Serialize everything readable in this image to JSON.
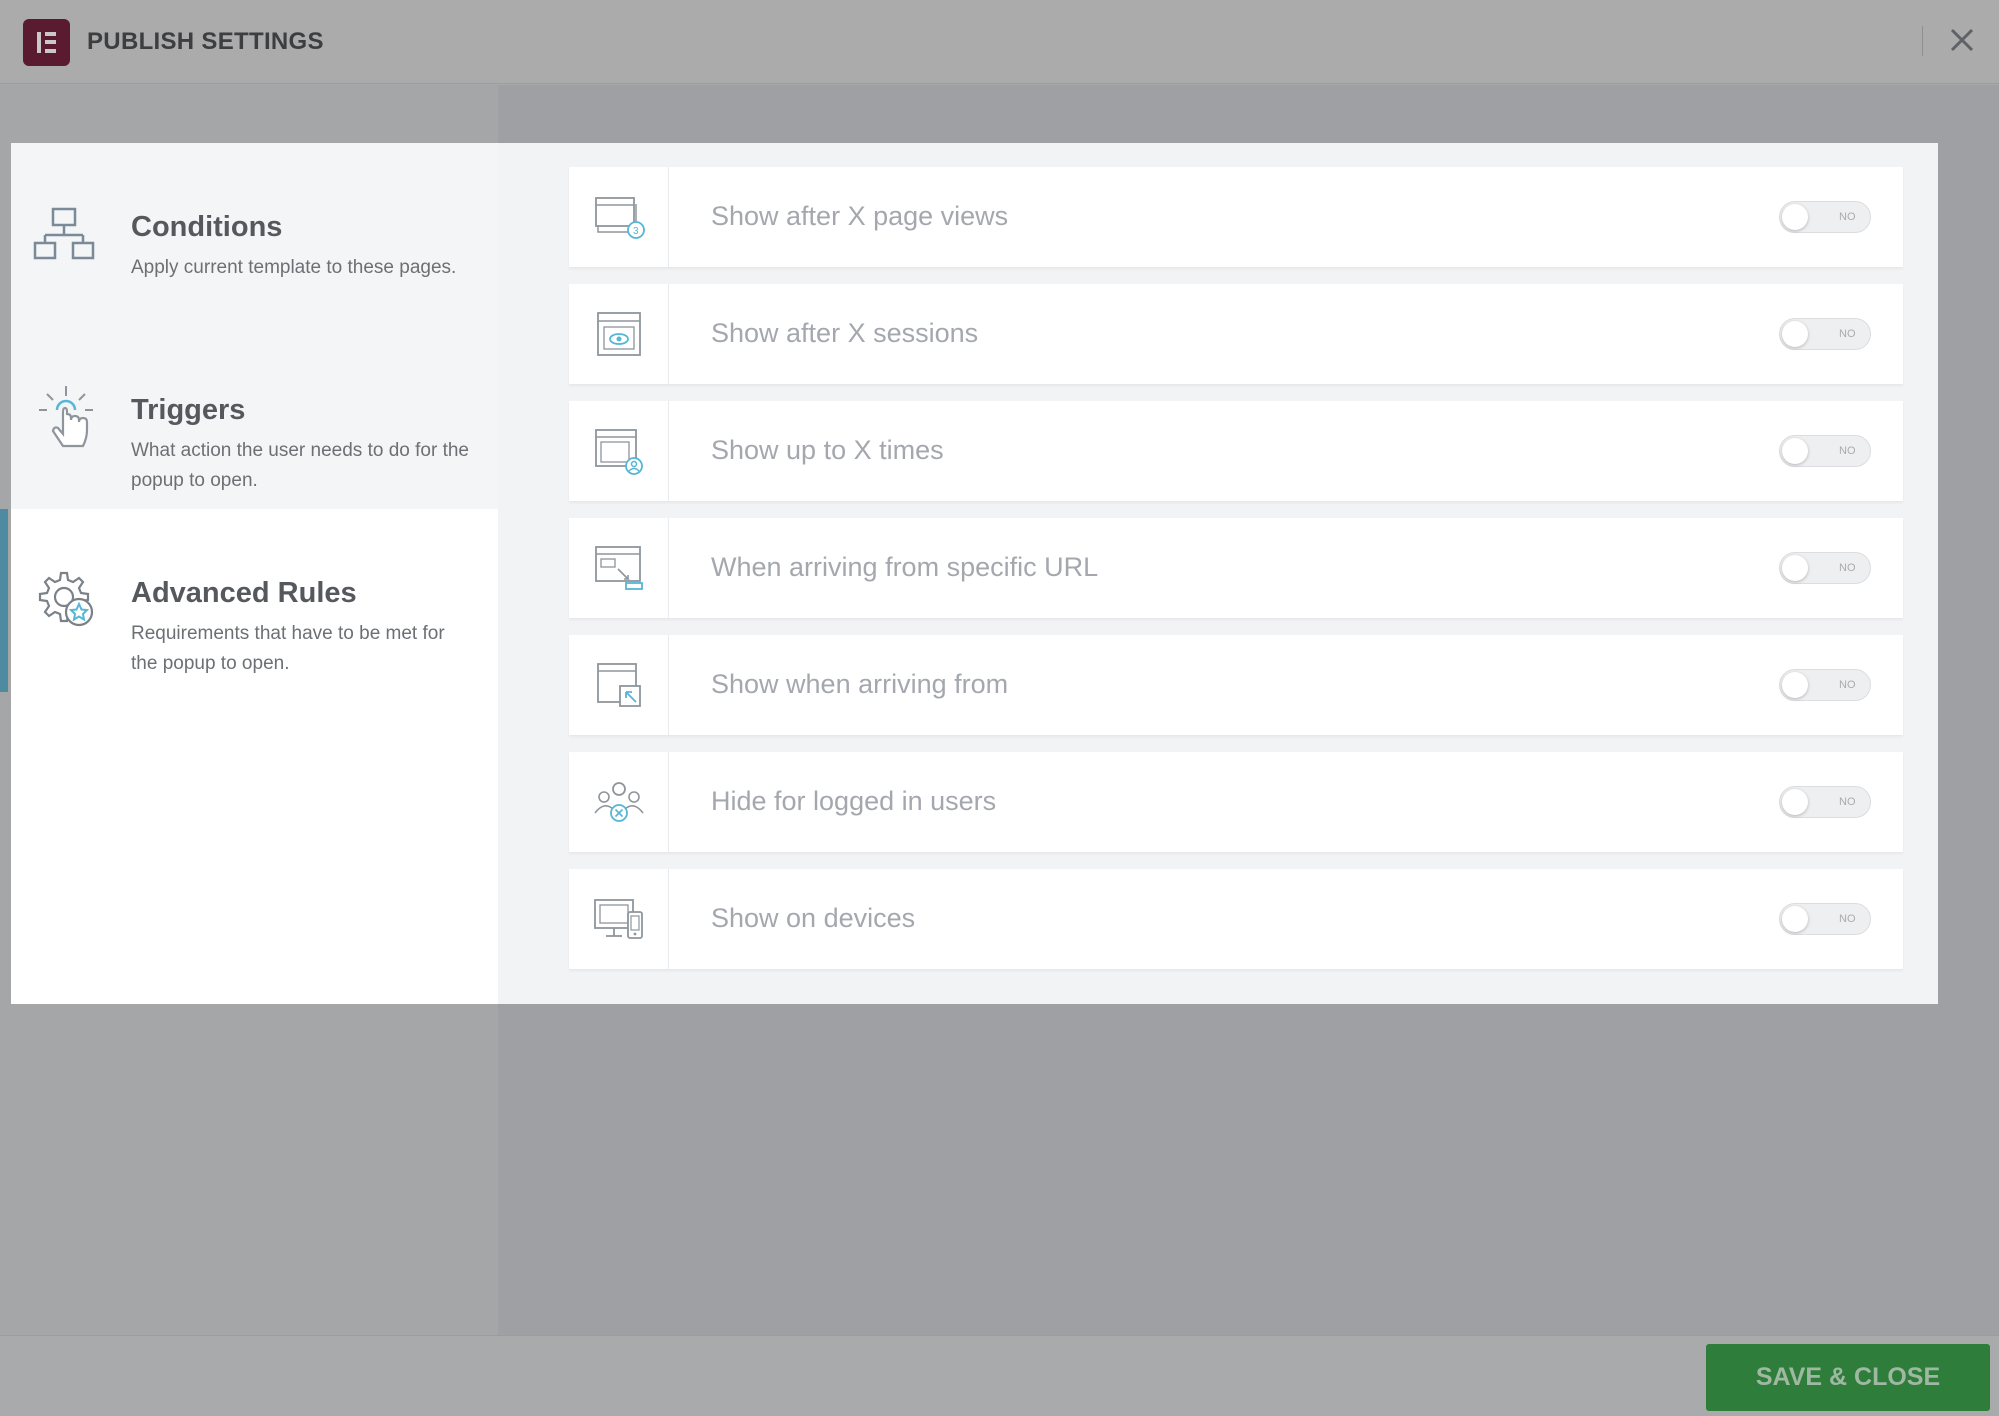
{
  "header": {
    "title": "PUBLISH SETTINGS",
    "logo_icon": "elementor-logo",
    "close_icon": "close-icon"
  },
  "menu": {
    "items": [
      {
        "title": "Conditions",
        "description": "Apply current template to these pages.",
        "icon": "sitemap-icon",
        "active": false
      },
      {
        "title": "Triggers",
        "description": "What action the user needs to do for the popup to open.",
        "icon": "hand-click-icon",
        "active": false
      },
      {
        "title": "Advanced Rules",
        "description": "Requirements that have to be met for the popup to open.",
        "icon": "gear-star-icon",
        "active": true
      }
    ]
  },
  "rules": [
    {
      "label": "Show after X page views",
      "icon": "page-views-icon",
      "toggle": "NO"
    },
    {
      "label": "Show after X sessions",
      "icon": "sessions-icon",
      "toggle": "NO"
    },
    {
      "label": "Show up to X times",
      "icon": "times-icon",
      "toggle": "NO"
    },
    {
      "label": "When arriving from specific URL",
      "icon": "url-icon",
      "toggle": "NO"
    },
    {
      "label": "Show when arriving from",
      "icon": "arriving-from-icon",
      "toggle": "NO"
    },
    {
      "label": "Hide for logged in users",
      "icon": "users-icon",
      "toggle": "NO"
    },
    {
      "label": "Show on devices",
      "icon": "devices-icon",
      "toggle": "NO"
    }
  ],
  "footer": {
    "save_label": "SAVE & CLOSE"
  },
  "colors": {
    "accent": "#4e8aa0",
    "save_button": "#2e7d3a",
    "logo": "#5a1a30"
  }
}
